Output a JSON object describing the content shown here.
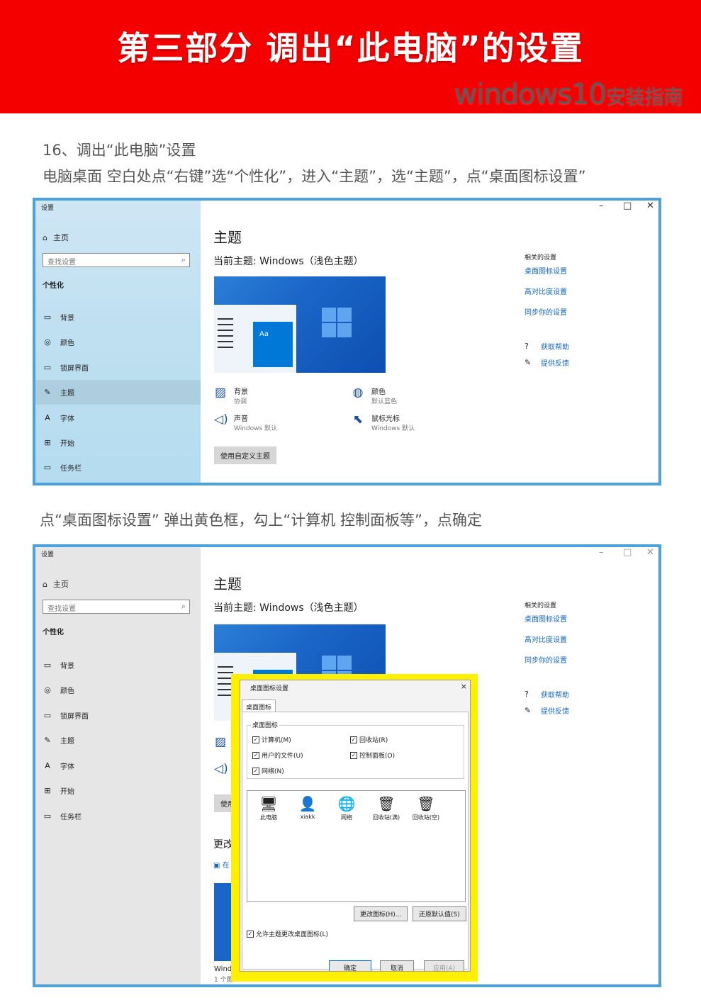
{
  "banner": {
    "title": "第三部分 调出“此电脑”的设置",
    "sub_main": "windows10",
    "sub_small": "安装指南"
  },
  "step": {
    "title": "16、调出“此电脑”设置",
    "desc": "电脑桌面 空白处点“右键”选“个性化”，进入“主题”，选“主题”，点“桌面图标设置”",
    "desc2": "点“桌面图标设置” 弹出黄色框，勾上“计算机 控制面板等”，点确定"
  },
  "settings": {
    "app_title": "设置",
    "controls": {
      "min": "–",
      "max": "□",
      "close": "✕"
    },
    "home": "主页",
    "search_placeholder": "查找设置",
    "section": "个性化",
    "nav": [
      {
        "icon": "▭",
        "label": "背景"
      },
      {
        "icon": "◎",
        "label": "颜色"
      },
      {
        "icon": "▭",
        "label": "锁屏界面"
      },
      {
        "icon": "✎",
        "label": "主题"
      },
      {
        "icon": "A",
        "label": "字体"
      },
      {
        "icon": "⊞",
        "label": "开始"
      },
      {
        "icon": "▭",
        "label": "任务栏"
      }
    ],
    "page_title": "主题",
    "current": "当前主题: Windows（浅色主题）",
    "items": [
      {
        "icon": "▨",
        "title": "背景",
        "sub": "协调"
      },
      {
        "icon": "◍",
        "title": "颜色",
        "sub": "默认蓝色"
      },
      {
        "icon": "◁)",
        "title": "声音",
        "sub": "Windows 默认"
      },
      {
        "icon": "⬉",
        "title": "鼠标光标",
        "sub": "Windows 默认"
      }
    ],
    "custom_button": "使用自定义主题",
    "related_header": "相关的设置",
    "related_links": [
      "桌面图标设置",
      "高对比度设置",
      "同步你的设置"
    ],
    "help": [
      {
        "icon": "?",
        "label": "获取帮助"
      },
      {
        "icon": "✎",
        "label": "提供反馈"
      }
    ],
    "partial": {
      "use": "使用",
      "change": "更改",
      "store": "在",
      "windo": "Windo",
      "count": "1 个图"
    },
    "preview_aa": "Aa"
  },
  "dialog": {
    "title": "桌面图标设置",
    "close": "×",
    "tab": "桌面图标",
    "group": "桌面图标",
    "checks": [
      {
        "label": "计算机(M)",
        "checked": true
      },
      {
        "label": "回收站(R)",
        "checked": true
      },
      {
        "label": "用户的文件(U)",
        "checked": true
      },
      {
        "label": "控制面板(O)",
        "checked": true
      },
      {
        "label": "网络(N)",
        "checked": true
      }
    ],
    "icons": [
      {
        "glyph": "🖥",
        "label": "此电脑"
      },
      {
        "glyph": "👤",
        "label": "xiakk"
      },
      {
        "glyph": "🌐",
        "label": "网络"
      },
      {
        "glyph": "🗑",
        "label": "回收站(满)"
      },
      {
        "glyph": "🗑",
        "label": "回收站(空)"
      }
    ],
    "change_icon": "更改图标(H)...",
    "restore": "还原默认值(S)",
    "allow_theme": "允许主题更改桌面图标(L)",
    "ok": "确定",
    "cancel": "取消",
    "apply": "应用(A)"
  }
}
